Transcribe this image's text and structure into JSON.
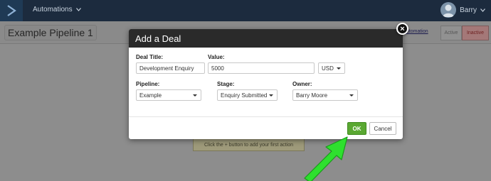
{
  "topbar": {
    "nav_label": "Automations",
    "user_name": "Barry"
  },
  "page": {
    "pipeline_title": "Example Pipeline 1",
    "edit_link": "automation",
    "status_active": "Active",
    "status_inactive": "Inactive",
    "first_action_hint": "Click the + button to add your first action"
  },
  "modal": {
    "title": "Add a Deal",
    "deal_title_label": "Deal Title:",
    "deal_title_value": "Development Enquiry",
    "value_label": "Value:",
    "value_value": "5000",
    "currency": "USD",
    "pipeline_label": "Pipeline:",
    "pipeline_value": "Example",
    "stage_label": "Stage:",
    "stage_value": "Enquiry Submitted",
    "owner_label": "Owner:",
    "owner_value": "Barry Moore",
    "ok_label": "OK",
    "cancel_label": "Cancel",
    "close_glyph": "×"
  },
  "colors": {
    "header_bg": "#1c2b3e",
    "modal_header": "#2a2a2a",
    "ok_green": "#5aa832",
    "arrow_green": "#2ee02e"
  }
}
